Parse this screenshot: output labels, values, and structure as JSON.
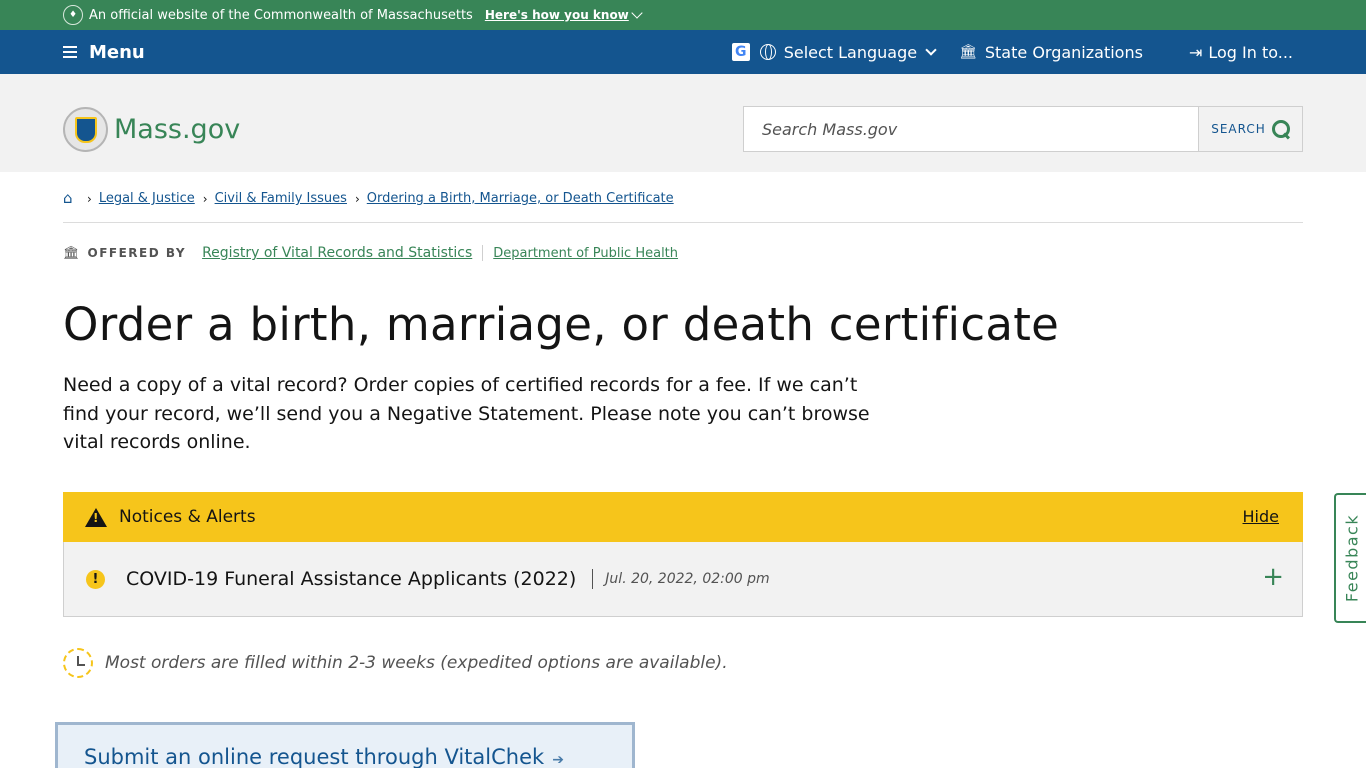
{
  "official_banner": {
    "text": "An official website of the Commonwealth of Massachusetts",
    "how_link": "Here's how you know"
  },
  "utility_nav": {
    "menu_label": "Menu",
    "google_badge": "G",
    "language_label": "Select Language",
    "orgs_label": "State Organizations",
    "login_label": "Log In to..."
  },
  "header": {
    "logo_text": "Mass.gov",
    "search_placeholder": "Search Mass.gov",
    "search_button": "SEARCH"
  },
  "breadcrumbs": {
    "items": [
      "Legal & Justice",
      "Civil & Family Issues",
      "Ordering a Birth, Marriage, or Death Certificate"
    ]
  },
  "offered_by": {
    "label": "OFFERED BY",
    "orgs": [
      "Registry of Vital Records and Statistics",
      "Department of Public Health"
    ]
  },
  "page": {
    "title": "Order a birth, marriage, or death certificate",
    "lede": "Need a copy of a vital record? Order copies of certified records for a fee. If we can’t find your record, we’ll send you a Negative Statement. Please note you can’t browse vital records online."
  },
  "alerts": {
    "heading": "Notices & Alerts",
    "hide_label": "Hide",
    "items": [
      {
        "title": "COVID-19 Funeral Assistance Applicants (2022)",
        "date": "Jul. 20, 2022, 02:00 pm"
      }
    ]
  },
  "timing": {
    "text": "Most orders are filled within 2-3 weeks (expedited options are available)."
  },
  "callout": {
    "label": "Submit an online request through VitalChek"
  },
  "feedback": {
    "label": "Feedback"
  },
  "colors": {
    "green": "#388557",
    "blue": "#14558f",
    "yellow": "#f6c51b",
    "gray_bg": "#f2f2f2"
  }
}
